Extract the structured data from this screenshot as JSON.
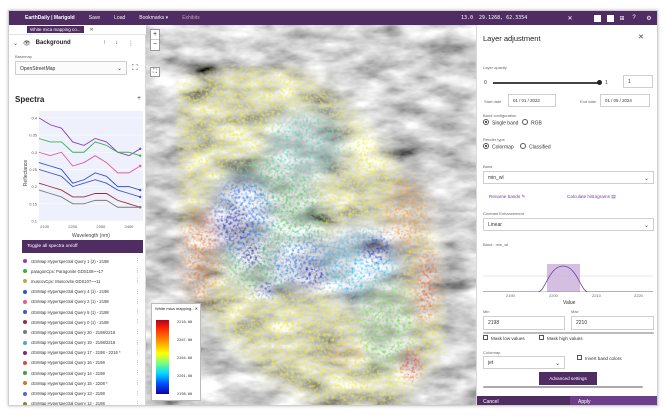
{
  "topbar": {
    "app_name": "EarthDaily | Marigold",
    "menu": [
      "Save",
      "Load",
      "Bookmarks ▾",
      "Exhibits"
    ],
    "zoom": "13.0",
    "coords": "29.1268, 62.3354",
    "colors": {
      "bar": "#4f2d63"
    }
  },
  "left": {
    "layer_tab_label": "White mica mapping co...",
    "background_title": "Background",
    "basemap_label": "Basemap",
    "basemap_value": "OpenStreetMap",
    "spectra_title": "Spectra",
    "chart_data": {
      "type": "line",
      "title": "",
      "xlabel": "Wavelength (nm)",
      "ylabel": "Reflectance",
      "x_ticks": [
        "2100",
        "2200",
        "2300",
        "2400"
      ],
      "y_ticks": [
        "0.1",
        "0.15",
        "0.2",
        "0.25",
        "0.3",
        "0.35",
        "0.4"
      ],
      "xlim": [
        2080,
        2450
      ],
      "ylim": [
        0.1,
        0.42
      ],
      "x": [
        2080,
        2120,
        2160,
        2200,
        2240,
        2280,
        2320,
        2360,
        2400,
        2440
      ],
      "series": [
        {
          "color": "#8b3fc7",
          "values": [
            0.4,
            0.38,
            0.37,
            0.33,
            0.32,
            0.34,
            0.33,
            0.3,
            0.29,
            0.31
          ]
        },
        {
          "color": "#35b24a",
          "values": [
            0.34,
            0.33,
            0.33,
            0.3,
            0.3,
            0.33,
            0.32,
            0.3,
            0.3,
            0.29
          ]
        },
        {
          "color": "#e05aa0",
          "values": [
            0.3,
            0.29,
            0.3,
            0.26,
            0.27,
            0.29,
            0.27,
            0.24,
            0.24,
            0.26
          ]
        },
        {
          "color": "#2f54d6",
          "values": [
            0.27,
            0.26,
            0.25,
            0.21,
            0.22,
            0.24,
            0.23,
            0.2,
            0.2,
            0.19
          ]
        },
        {
          "color": "#3f58c8",
          "values": [
            0.25,
            0.24,
            0.23,
            0.2,
            0.21,
            0.22,
            0.21,
            0.19,
            0.18,
            0.17
          ]
        },
        {
          "color": "#9c2b3f",
          "values": [
            0.21,
            0.2,
            0.19,
            0.17,
            0.17,
            0.18,
            0.18,
            0.16,
            0.15,
            0.14
          ]
        },
        {
          "color": "#7a7a7a",
          "values": [
            0.19,
            0.18,
            0.17,
            0.15,
            0.15,
            0.16,
            0.16,
            0.14,
            0.14,
            0.14
          ]
        }
      ]
    },
    "toggle_label": "Toggle all spectra on/off",
    "queries": [
      {
        "label": "cEnMap Hyperspectral Query 1 (2) - 2198",
        "color": "#8b3fc7"
      },
      {
        "label": "paragonCpx: Paragonite GDS108~~17",
        "color": "#35b24a"
      },
      {
        "label": "muscovCpx: Muscovite GDS107~~11",
        "color": "#c4a44a"
      },
      {
        "label": "cEnMap Hyperspectral Query 4 (1) - 2198",
        "color": "#2f54d6"
      },
      {
        "label": "cEnMap Hyperspectral Query 2 (1) - 2198",
        "color": "#e05aa0"
      },
      {
        "label": "cEnMap Hyperspectral Query 5 (1) - 2198",
        "color": "#3f58c8"
      },
      {
        "label": "cEnMap Hyperspectral Query 0 (1) - 2198",
        "color": "#9c2b3f"
      },
      {
        "label": "cEnMap Hyperspectral Query 20 - 2198/2216",
        "color": "#7a7a7a"
      },
      {
        "label": "cEnMap Hyperspectral Query 19 - 2198/2216",
        "color": "#5aa0d6"
      },
      {
        "label": "cEnMap Hyperspectral Query 17 - 2198 - 2216 *",
        "color": "#7a2b7a"
      },
      {
        "label": "cEnMap Hyperspectral Query 16 - 2198",
        "color": "#d64a4a"
      },
      {
        "label": "cEnMap Hyperspectral Query 14 - 2198",
        "color": "#4a9a4a"
      },
      {
        "label": "cEnMap Hyperspectral Query 15 - 2208 *",
        "color": "#c27a2b"
      },
      {
        "label": "cEnMap Hyperspectral Query 13 - 2198",
        "color": "#4a6ad6"
      },
      {
        "label": "cEnMap Hyperspectral Query 12 - 2198",
        "color": "#8a8a2b"
      }
    ]
  },
  "map": {
    "legend_title": "White mica mapping...",
    "legend_ticks": [
      "2210.00",
      "2207.00",
      "2204.00",
      "2201.00",
      "2198.00"
    ]
  },
  "right": {
    "title": "Layer adjustment",
    "opacity_label": "Layer opacity",
    "opacity_min": "0",
    "opacity_max": "1",
    "opacity_value": "1",
    "opacity_fraction": 1,
    "start_label": "Start date",
    "start_value": "01 / 01 / 2022",
    "end_label": "End date",
    "end_value": "01 / 05 / 2024",
    "band_config_label": "Band configuration",
    "single_band": "Single band",
    "rgb": "RGB",
    "render_type_label": "Render type",
    "colormap_opt": "Colormap",
    "classified_opt": "Classified",
    "band_label": "Band",
    "band_value": "min_wl",
    "rename_link": "Rename bands",
    "histogram_link": "Calculate histograms",
    "contrast_label": "Contrast Enhancement",
    "contrast_value": "Linear",
    "band_hist_label": "Band : min_wl",
    "hist_ticks": [
      "2190",
      "2200",
      "2210",
      "2220"
    ],
    "hist_xlabel": "Value",
    "min_label": "Min",
    "min_value": "2198",
    "max_label": "Max",
    "max_value": "2210",
    "mask_low": "Mask low values",
    "mask_high": "Mask high values",
    "colormap_label": "Colormap",
    "colormap_value": "jet",
    "invert_label": "Invert band colors",
    "advanced_btn": "Advanced settings",
    "cancel_btn": "Cancel",
    "apply_btn": "Apply"
  }
}
